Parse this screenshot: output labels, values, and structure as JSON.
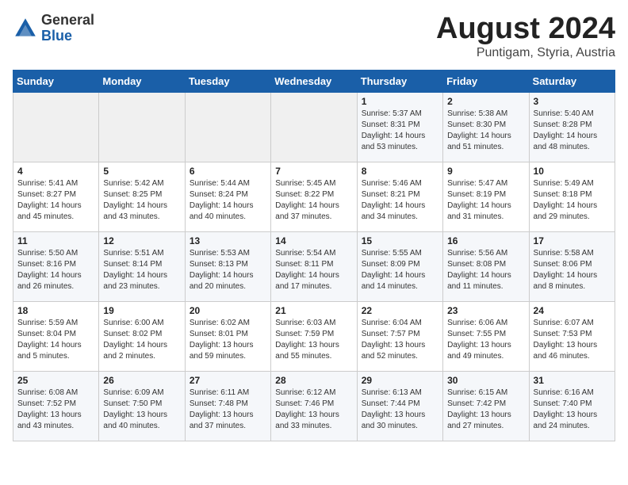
{
  "header": {
    "logo_general": "General",
    "logo_blue": "Blue",
    "month_title": "August 2024",
    "subtitle": "Puntigam, Styria, Austria"
  },
  "weekdays": [
    "Sunday",
    "Monday",
    "Tuesday",
    "Wednesday",
    "Thursday",
    "Friday",
    "Saturday"
  ],
  "weeks": [
    [
      {
        "day": "",
        "info": ""
      },
      {
        "day": "",
        "info": ""
      },
      {
        "day": "",
        "info": ""
      },
      {
        "day": "",
        "info": ""
      },
      {
        "day": "1",
        "info": "Sunrise: 5:37 AM\nSunset: 8:31 PM\nDaylight: 14 hours\nand 53 minutes."
      },
      {
        "day": "2",
        "info": "Sunrise: 5:38 AM\nSunset: 8:30 PM\nDaylight: 14 hours\nand 51 minutes."
      },
      {
        "day": "3",
        "info": "Sunrise: 5:40 AM\nSunset: 8:28 PM\nDaylight: 14 hours\nand 48 minutes."
      }
    ],
    [
      {
        "day": "4",
        "info": "Sunrise: 5:41 AM\nSunset: 8:27 PM\nDaylight: 14 hours\nand 45 minutes."
      },
      {
        "day": "5",
        "info": "Sunrise: 5:42 AM\nSunset: 8:25 PM\nDaylight: 14 hours\nand 43 minutes."
      },
      {
        "day": "6",
        "info": "Sunrise: 5:44 AM\nSunset: 8:24 PM\nDaylight: 14 hours\nand 40 minutes."
      },
      {
        "day": "7",
        "info": "Sunrise: 5:45 AM\nSunset: 8:22 PM\nDaylight: 14 hours\nand 37 minutes."
      },
      {
        "day": "8",
        "info": "Sunrise: 5:46 AM\nSunset: 8:21 PM\nDaylight: 14 hours\nand 34 minutes."
      },
      {
        "day": "9",
        "info": "Sunrise: 5:47 AM\nSunset: 8:19 PM\nDaylight: 14 hours\nand 31 minutes."
      },
      {
        "day": "10",
        "info": "Sunrise: 5:49 AM\nSunset: 8:18 PM\nDaylight: 14 hours\nand 29 minutes."
      }
    ],
    [
      {
        "day": "11",
        "info": "Sunrise: 5:50 AM\nSunset: 8:16 PM\nDaylight: 14 hours\nand 26 minutes."
      },
      {
        "day": "12",
        "info": "Sunrise: 5:51 AM\nSunset: 8:14 PM\nDaylight: 14 hours\nand 23 minutes."
      },
      {
        "day": "13",
        "info": "Sunrise: 5:53 AM\nSunset: 8:13 PM\nDaylight: 14 hours\nand 20 minutes."
      },
      {
        "day": "14",
        "info": "Sunrise: 5:54 AM\nSunset: 8:11 PM\nDaylight: 14 hours\nand 17 minutes."
      },
      {
        "day": "15",
        "info": "Sunrise: 5:55 AM\nSunset: 8:09 PM\nDaylight: 14 hours\nand 14 minutes."
      },
      {
        "day": "16",
        "info": "Sunrise: 5:56 AM\nSunset: 8:08 PM\nDaylight: 14 hours\nand 11 minutes."
      },
      {
        "day": "17",
        "info": "Sunrise: 5:58 AM\nSunset: 8:06 PM\nDaylight: 14 hours\nand 8 minutes."
      }
    ],
    [
      {
        "day": "18",
        "info": "Sunrise: 5:59 AM\nSunset: 8:04 PM\nDaylight: 14 hours\nand 5 minutes."
      },
      {
        "day": "19",
        "info": "Sunrise: 6:00 AM\nSunset: 8:02 PM\nDaylight: 14 hours\nand 2 minutes."
      },
      {
        "day": "20",
        "info": "Sunrise: 6:02 AM\nSunset: 8:01 PM\nDaylight: 13 hours\nand 59 minutes."
      },
      {
        "day": "21",
        "info": "Sunrise: 6:03 AM\nSunset: 7:59 PM\nDaylight: 13 hours\nand 55 minutes."
      },
      {
        "day": "22",
        "info": "Sunrise: 6:04 AM\nSunset: 7:57 PM\nDaylight: 13 hours\nand 52 minutes."
      },
      {
        "day": "23",
        "info": "Sunrise: 6:06 AM\nSunset: 7:55 PM\nDaylight: 13 hours\nand 49 minutes."
      },
      {
        "day": "24",
        "info": "Sunrise: 6:07 AM\nSunset: 7:53 PM\nDaylight: 13 hours\nand 46 minutes."
      }
    ],
    [
      {
        "day": "25",
        "info": "Sunrise: 6:08 AM\nSunset: 7:52 PM\nDaylight: 13 hours\nand 43 minutes."
      },
      {
        "day": "26",
        "info": "Sunrise: 6:09 AM\nSunset: 7:50 PM\nDaylight: 13 hours\nand 40 minutes."
      },
      {
        "day": "27",
        "info": "Sunrise: 6:11 AM\nSunset: 7:48 PM\nDaylight: 13 hours\nand 37 minutes."
      },
      {
        "day": "28",
        "info": "Sunrise: 6:12 AM\nSunset: 7:46 PM\nDaylight: 13 hours\nand 33 minutes."
      },
      {
        "day": "29",
        "info": "Sunrise: 6:13 AM\nSunset: 7:44 PM\nDaylight: 13 hours\nand 30 minutes."
      },
      {
        "day": "30",
        "info": "Sunrise: 6:15 AM\nSunset: 7:42 PM\nDaylight: 13 hours\nand 27 minutes."
      },
      {
        "day": "31",
        "info": "Sunrise: 6:16 AM\nSunset: 7:40 PM\nDaylight: 13 hours\nand 24 minutes."
      }
    ]
  ]
}
